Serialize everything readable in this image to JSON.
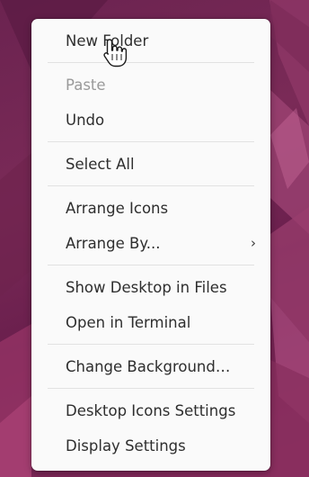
{
  "menu": {
    "items": [
      {
        "label": "New Folder",
        "enabled": true
      },
      {
        "label": "Paste",
        "enabled": false
      },
      {
        "label": "Undo",
        "enabled": true
      },
      {
        "label": "Select All",
        "enabled": true
      },
      {
        "label": "Arrange Icons",
        "enabled": true
      },
      {
        "label": "Arrange By...",
        "enabled": true,
        "submenu": true
      },
      {
        "label": "Show Desktop in Files",
        "enabled": true
      },
      {
        "label": "Open in Terminal",
        "enabled": true
      },
      {
        "label": "Change Background…",
        "enabled": true
      },
      {
        "label": "Desktop Icons Settings",
        "enabled": true
      },
      {
        "label": "Display Settings",
        "enabled": true
      }
    ],
    "submenu_indicator": "›"
  },
  "cursor": {
    "type": "hand-pointer",
    "over": "New Folder"
  },
  "colors": {
    "wallpaper": "#6b2350",
    "menu_bg": "#fafafa",
    "text": "#2e2e2e",
    "disabled_text": "#9a9a9a"
  }
}
